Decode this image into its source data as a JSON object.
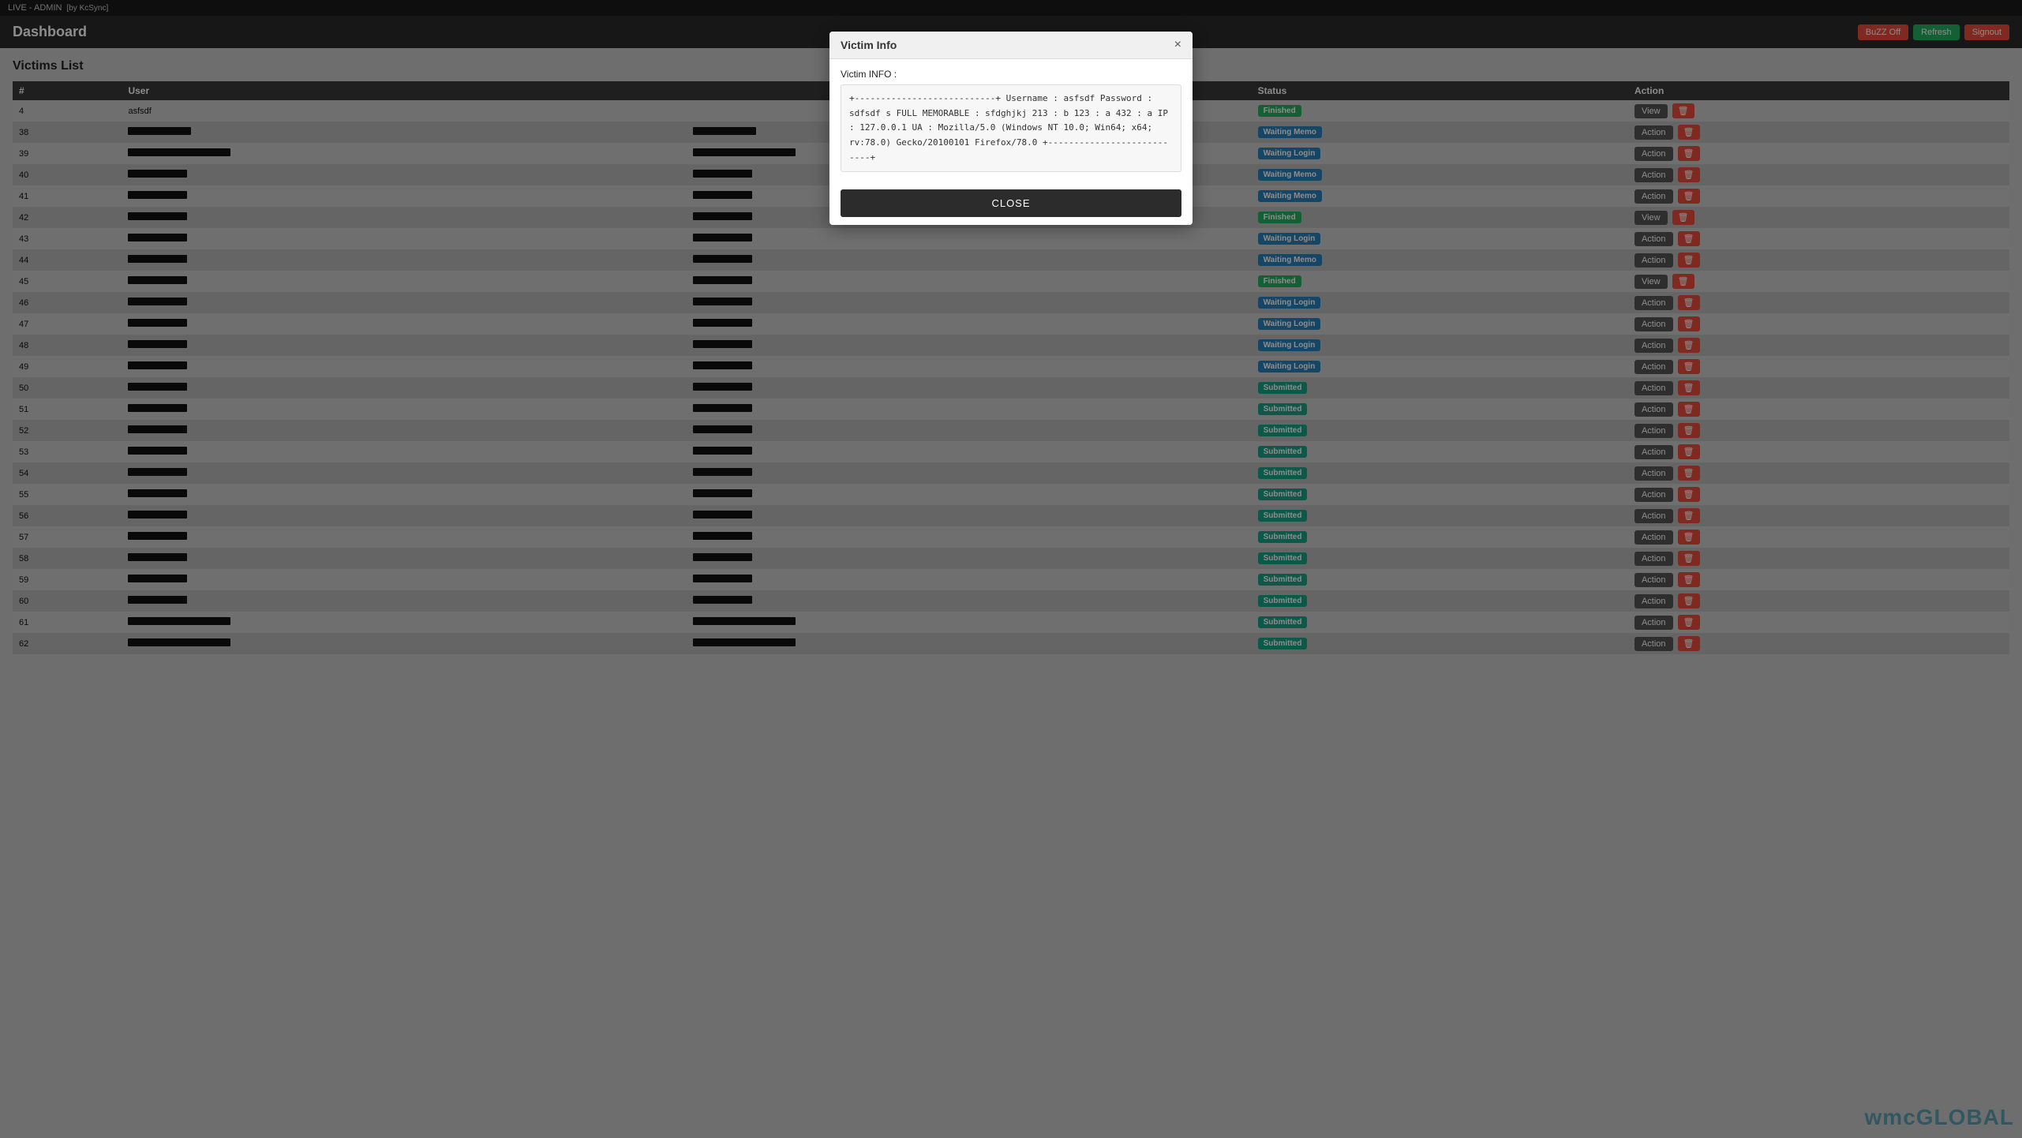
{
  "topbar": {
    "title": "LIVE - ADMIN",
    "subtitle": "[by KcSync]"
  },
  "header": {
    "title": "Dashboard",
    "buttons": {
      "buzz": "BuZZ Off",
      "refresh": "Refresh",
      "signout": "Signout"
    }
  },
  "page": {
    "victims_title": "Victims List",
    "columns": [
      "#",
      "User",
      "",
      "Status",
      "Action"
    ]
  },
  "modal": {
    "title": "Victim Info",
    "info_label": "Victim INFO :",
    "info_content": "+---------------------------+\nUsername : asfsdf\nPassword : sdfsdf s\nFULL MEMORABLE : sfdghjkj\n213 : b\n123 : a\n432 : a\nIP : 127.0.0.1\nUA : Mozilla/5.0 (Windows NT 10.0; Win64; x64; rv:78.0) Gecko/20100101 Firefox/78.0\n+---------------------------+",
    "close_label": "CLOSE"
  },
  "rows": [
    {
      "id": 4,
      "user": "asfsdf",
      "user_bar": 60,
      "col3_bar": 0,
      "status": "Finished",
      "status_class": "status-finished",
      "action_type": "view"
    },
    {
      "id": 38,
      "user": "",
      "user_bar": 80,
      "col3_bar": 80,
      "status": "Waiting Memo",
      "status_class": "status-waiting-memo",
      "action_type": "action"
    },
    {
      "id": 39,
      "user": "",
      "user_bar": 130,
      "col3_bar": 130,
      "status": "Waiting Login",
      "status_class": "status-waiting-login",
      "action_type": "action"
    },
    {
      "id": 40,
      "user": "",
      "user_bar": 75,
      "col3_bar": 75,
      "status": "Waiting Memo",
      "status_class": "status-waiting-memo",
      "action_type": "action"
    },
    {
      "id": 41,
      "user": "",
      "user_bar": 75,
      "col3_bar": 75,
      "status": "Waiting Memo",
      "status_class": "status-waiting-memo",
      "action_type": "action"
    },
    {
      "id": 42,
      "user": "",
      "user_bar": 75,
      "col3_bar": 75,
      "status": "Finished",
      "status_class": "status-finished",
      "action_type": "view"
    },
    {
      "id": 43,
      "user": "",
      "user_bar": 75,
      "col3_bar": 75,
      "status": "Waiting Login",
      "status_class": "status-waiting-login",
      "action_type": "action"
    },
    {
      "id": 44,
      "user": "",
      "user_bar": 75,
      "col3_bar": 75,
      "status": "Waiting Memo",
      "status_class": "status-waiting-memo",
      "action_type": "action"
    },
    {
      "id": 45,
      "user": "",
      "user_bar": 75,
      "col3_bar": 75,
      "status": "Finished",
      "status_class": "status-finished",
      "action_type": "view"
    },
    {
      "id": 46,
      "user": "",
      "user_bar": 75,
      "col3_bar": 75,
      "status": "Waiting Login",
      "status_class": "status-waiting-login",
      "action_type": "action"
    },
    {
      "id": 47,
      "user": "",
      "user_bar": 75,
      "col3_bar": 75,
      "status": "Waiting Login",
      "status_class": "status-waiting-login",
      "action_type": "action"
    },
    {
      "id": 48,
      "user": "",
      "user_bar": 75,
      "col3_bar": 75,
      "status": "Waiting Login",
      "status_class": "status-waiting-login",
      "action_type": "action"
    },
    {
      "id": 49,
      "user": "",
      "user_bar": 75,
      "col3_bar": 75,
      "status": "Waiting Login",
      "status_class": "status-waiting-login",
      "action_type": "action"
    },
    {
      "id": 50,
      "user": "",
      "user_bar": 75,
      "col3_bar": 75,
      "status": "Submitted",
      "status_class": "status-submitted",
      "action_type": "action"
    },
    {
      "id": 51,
      "user": "",
      "user_bar": 75,
      "col3_bar": 75,
      "status": "Submitted",
      "status_class": "status-submitted",
      "action_type": "action"
    },
    {
      "id": 52,
      "user": "",
      "user_bar": 75,
      "col3_bar": 75,
      "status": "Submitted",
      "status_class": "status-submitted",
      "action_type": "action"
    },
    {
      "id": 53,
      "user": "",
      "user_bar": 75,
      "col3_bar": 75,
      "status": "Submitted",
      "status_class": "status-submitted",
      "action_type": "action"
    },
    {
      "id": 54,
      "user": "",
      "user_bar": 75,
      "col3_bar": 75,
      "status": "Submitted",
      "status_class": "status-submitted",
      "action_type": "action"
    },
    {
      "id": 55,
      "user": "",
      "user_bar": 75,
      "col3_bar": 75,
      "status": "Submitted",
      "status_class": "status-submitted",
      "action_type": "action"
    },
    {
      "id": 56,
      "user": "",
      "user_bar": 75,
      "col3_bar": 75,
      "status": "Submitted",
      "status_class": "status-submitted",
      "action_type": "action"
    },
    {
      "id": 57,
      "user": "",
      "user_bar": 75,
      "col3_bar": 75,
      "status": "Submitted",
      "status_class": "status-submitted",
      "action_type": "action"
    },
    {
      "id": 58,
      "user": "",
      "user_bar": 75,
      "col3_bar": 75,
      "status": "Submitted",
      "status_class": "status-submitted",
      "action_type": "action"
    },
    {
      "id": 59,
      "user": "",
      "user_bar": 75,
      "col3_bar": 75,
      "status": "Submitted",
      "status_class": "status-submitted",
      "action_type": "action"
    },
    {
      "id": 60,
      "user": "",
      "user_bar": 75,
      "col3_bar": 75,
      "status": "Submitted",
      "status_class": "status-submitted",
      "action_type": "action"
    },
    {
      "id": 61,
      "user": "",
      "user_bar": 130,
      "col3_bar": 130,
      "status": "Submitted",
      "status_class": "status-submitted",
      "action_type": "action"
    },
    {
      "id": 62,
      "user": "",
      "user_bar": 130,
      "col3_bar": 130,
      "status": "Submitted",
      "status_class": "status-submitted",
      "action_type": "action"
    }
  ],
  "buttons": {
    "action_label": "Action",
    "view_label": "View",
    "delete_label": "×"
  },
  "watermark": {
    "text1": "wmc",
    "text2": "GLOBAL"
  }
}
